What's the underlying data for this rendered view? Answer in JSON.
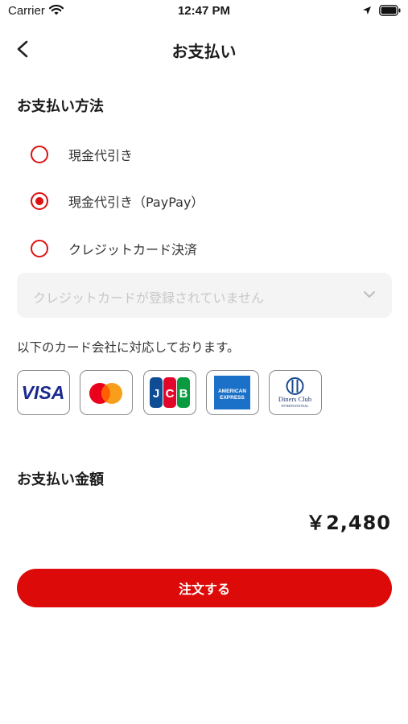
{
  "status_bar": {
    "carrier": "Carrier",
    "time": "12:47 PM"
  },
  "nav": {
    "title": "お支払い"
  },
  "payment_method": {
    "title": "お支払い方法",
    "options": [
      {
        "label": "現金代引き",
        "selected": false
      },
      {
        "label": "現金代引き（PayPay）",
        "selected": true
      },
      {
        "label": "クレジットカード決済",
        "selected": false
      }
    ],
    "card_select_placeholder": "クレジットカードが登録されていません"
  },
  "supported_cards_note": "以下のカード会社に対応しております。",
  "cards": [
    {
      "name": "VISA",
      "icon": "visa-logo"
    },
    {
      "name": "Mastercard",
      "icon": "mastercard-logo"
    },
    {
      "name": "JCB",
      "icon": "jcb-logo"
    },
    {
      "name": "American Express",
      "icon": "amex-logo",
      "lines": [
        "AMERICAN",
        "EXPRESS"
      ]
    },
    {
      "name": "Diners Club",
      "icon": "diners-club-logo",
      "lines": [
        "Diners Club",
        "INTERNATIONAL"
      ]
    }
  ],
  "amount_section": {
    "title": "お支払い金額",
    "amount": "￥2,480"
  },
  "order_button": {
    "label": "注文する"
  },
  "colors": {
    "accent": "#dd0a0a",
    "radio": "#dd1111",
    "select_bg": "#f4f4f4",
    "placeholder": "#c8c8c8"
  }
}
